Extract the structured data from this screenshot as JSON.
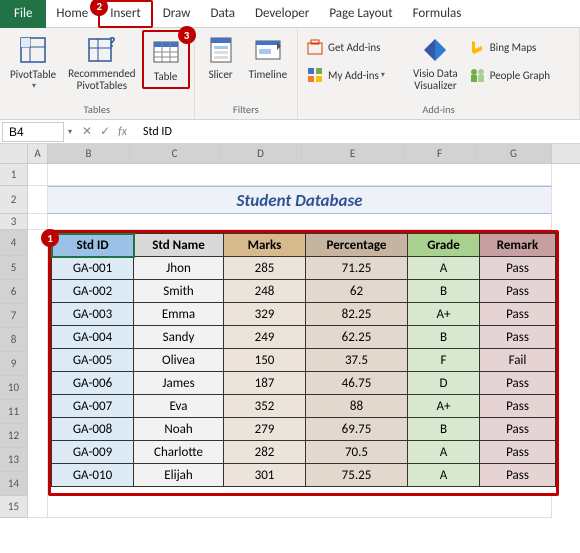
{
  "tabs": {
    "file": "File",
    "items": [
      "Home",
      "Insert",
      "Draw",
      "Data",
      "Developer",
      "Page Layout",
      "Formulas"
    ],
    "active": "Insert"
  },
  "steps": {
    "s1": "1",
    "s2": "2",
    "s3": "3"
  },
  "ribbon": {
    "pivottable": "PivotTable",
    "recommended": "Recommended\nPivotTables",
    "table": "Table",
    "slicer": "Slicer",
    "timeline": "Timeline",
    "getaddins": "Get Add-ins",
    "myaddins": "My Add-ins",
    "visio": "Visio Data\nVisualizer",
    "bingmaps": "Bing Maps",
    "peoplegraph": "People Graph",
    "groups": {
      "tables": "Tables",
      "filters": "Filters",
      "addins": "Add-ins"
    }
  },
  "formula_bar": {
    "namebox": "B4",
    "value": "Std ID",
    "fx": "fx"
  },
  "columns": [
    "A",
    "B",
    "C",
    "D",
    "E",
    "F",
    "G"
  ],
  "row_nums": [
    "1",
    "2",
    "3",
    "4",
    "5",
    "6",
    "7",
    "8",
    "9",
    "10",
    "11",
    "12",
    "13",
    "14",
    "15"
  ],
  "title": "Student Database",
  "table": {
    "headers": [
      "Std ID",
      "Std Name",
      "Marks",
      "Percentage",
      "Grade",
      "Remark"
    ],
    "rows": [
      [
        "GA-001",
        "Jhon",
        "285",
        "71.25",
        "A",
        "Pass"
      ],
      [
        "GA-002",
        "Smith",
        "248",
        "62",
        "B",
        "Pass"
      ],
      [
        "GA-003",
        "Emma",
        "329",
        "82.25",
        "A+",
        "Pass"
      ],
      [
        "GA-004",
        "Sandy",
        "249",
        "62.25",
        "B",
        "Pass"
      ],
      [
        "GA-005",
        "Olivea",
        "150",
        "37.5",
        "F",
        "Fail"
      ],
      [
        "GA-006",
        "James",
        "187",
        "46.75",
        "D",
        "Pass"
      ],
      [
        "GA-007",
        "Eva",
        "352",
        "88",
        "A+",
        "Pass"
      ],
      [
        "GA-008",
        "Noah",
        "279",
        "69.75",
        "B",
        "Pass"
      ],
      [
        "GA-009",
        "Charlotte",
        "282",
        "70.5",
        "A",
        "Pass"
      ],
      [
        "GA-010",
        "Elijah",
        "301",
        "75.25",
        "A",
        "Pass"
      ]
    ]
  }
}
